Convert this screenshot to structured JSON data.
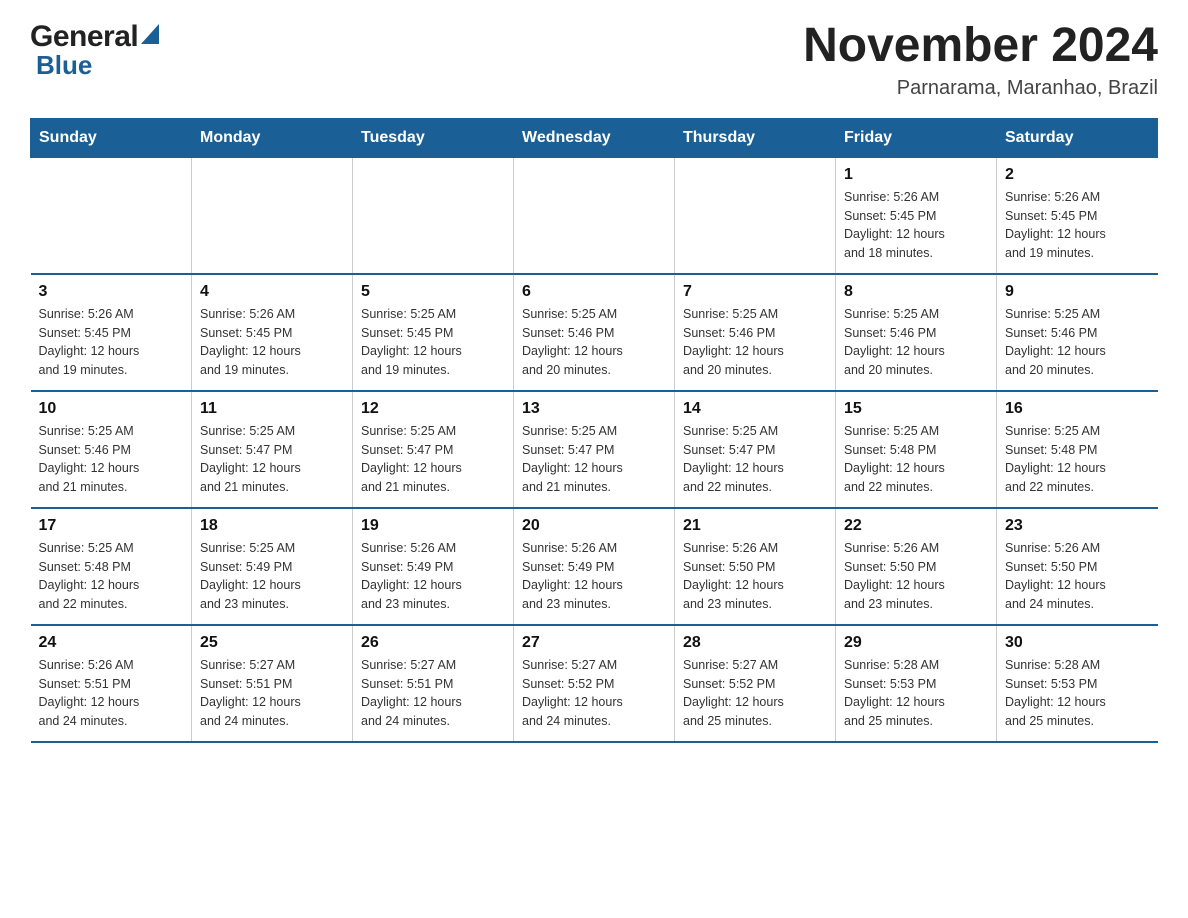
{
  "logo": {
    "general": "General",
    "blue": "Blue"
  },
  "header": {
    "month_year": "November 2024",
    "location": "Parnarama, Maranhao, Brazil"
  },
  "weekdays": [
    "Sunday",
    "Monday",
    "Tuesday",
    "Wednesday",
    "Thursday",
    "Friday",
    "Saturday"
  ],
  "weeks": [
    [
      {
        "day": "",
        "info": ""
      },
      {
        "day": "",
        "info": ""
      },
      {
        "day": "",
        "info": ""
      },
      {
        "day": "",
        "info": ""
      },
      {
        "day": "",
        "info": ""
      },
      {
        "day": "1",
        "info": "Sunrise: 5:26 AM\nSunset: 5:45 PM\nDaylight: 12 hours\nand 18 minutes."
      },
      {
        "day": "2",
        "info": "Sunrise: 5:26 AM\nSunset: 5:45 PM\nDaylight: 12 hours\nand 19 minutes."
      }
    ],
    [
      {
        "day": "3",
        "info": "Sunrise: 5:26 AM\nSunset: 5:45 PM\nDaylight: 12 hours\nand 19 minutes."
      },
      {
        "day": "4",
        "info": "Sunrise: 5:26 AM\nSunset: 5:45 PM\nDaylight: 12 hours\nand 19 minutes."
      },
      {
        "day": "5",
        "info": "Sunrise: 5:25 AM\nSunset: 5:45 PM\nDaylight: 12 hours\nand 19 minutes."
      },
      {
        "day": "6",
        "info": "Sunrise: 5:25 AM\nSunset: 5:46 PM\nDaylight: 12 hours\nand 20 minutes."
      },
      {
        "day": "7",
        "info": "Sunrise: 5:25 AM\nSunset: 5:46 PM\nDaylight: 12 hours\nand 20 minutes."
      },
      {
        "day": "8",
        "info": "Sunrise: 5:25 AM\nSunset: 5:46 PM\nDaylight: 12 hours\nand 20 minutes."
      },
      {
        "day": "9",
        "info": "Sunrise: 5:25 AM\nSunset: 5:46 PM\nDaylight: 12 hours\nand 20 minutes."
      }
    ],
    [
      {
        "day": "10",
        "info": "Sunrise: 5:25 AM\nSunset: 5:46 PM\nDaylight: 12 hours\nand 21 minutes."
      },
      {
        "day": "11",
        "info": "Sunrise: 5:25 AM\nSunset: 5:47 PM\nDaylight: 12 hours\nand 21 minutes."
      },
      {
        "day": "12",
        "info": "Sunrise: 5:25 AM\nSunset: 5:47 PM\nDaylight: 12 hours\nand 21 minutes."
      },
      {
        "day": "13",
        "info": "Sunrise: 5:25 AM\nSunset: 5:47 PM\nDaylight: 12 hours\nand 21 minutes."
      },
      {
        "day": "14",
        "info": "Sunrise: 5:25 AM\nSunset: 5:47 PM\nDaylight: 12 hours\nand 22 minutes."
      },
      {
        "day": "15",
        "info": "Sunrise: 5:25 AM\nSunset: 5:48 PM\nDaylight: 12 hours\nand 22 minutes."
      },
      {
        "day": "16",
        "info": "Sunrise: 5:25 AM\nSunset: 5:48 PM\nDaylight: 12 hours\nand 22 minutes."
      }
    ],
    [
      {
        "day": "17",
        "info": "Sunrise: 5:25 AM\nSunset: 5:48 PM\nDaylight: 12 hours\nand 22 minutes."
      },
      {
        "day": "18",
        "info": "Sunrise: 5:25 AM\nSunset: 5:49 PM\nDaylight: 12 hours\nand 23 minutes."
      },
      {
        "day": "19",
        "info": "Sunrise: 5:26 AM\nSunset: 5:49 PM\nDaylight: 12 hours\nand 23 minutes."
      },
      {
        "day": "20",
        "info": "Sunrise: 5:26 AM\nSunset: 5:49 PM\nDaylight: 12 hours\nand 23 minutes."
      },
      {
        "day": "21",
        "info": "Sunrise: 5:26 AM\nSunset: 5:50 PM\nDaylight: 12 hours\nand 23 minutes."
      },
      {
        "day": "22",
        "info": "Sunrise: 5:26 AM\nSunset: 5:50 PM\nDaylight: 12 hours\nand 23 minutes."
      },
      {
        "day": "23",
        "info": "Sunrise: 5:26 AM\nSunset: 5:50 PM\nDaylight: 12 hours\nand 24 minutes."
      }
    ],
    [
      {
        "day": "24",
        "info": "Sunrise: 5:26 AM\nSunset: 5:51 PM\nDaylight: 12 hours\nand 24 minutes."
      },
      {
        "day": "25",
        "info": "Sunrise: 5:27 AM\nSunset: 5:51 PM\nDaylight: 12 hours\nand 24 minutes."
      },
      {
        "day": "26",
        "info": "Sunrise: 5:27 AM\nSunset: 5:51 PM\nDaylight: 12 hours\nand 24 minutes."
      },
      {
        "day": "27",
        "info": "Sunrise: 5:27 AM\nSunset: 5:52 PM\nDaylight: 12 hours\nand 24 minutes."
      },
      {
        "day": "28",
        "info": "Sunrise: 5:27 AM\nSunset: 5:52 PM\nDaylight: 12 hours\nand 25 minutes."
      },
      {
        "day": "29",
        "info": "Sunrise: 5:28 AM\nSunset: 5:53 PM\nDaylight: 12 hours\nand 25 minutes."
      },
      {
        "day": "30",
        "info": "Sunrise: 5:28 AM\nSunset: 5:53 PM\nDaylight: 12 hours\nand 25 minutes."
      }
    ]
  ]
}
